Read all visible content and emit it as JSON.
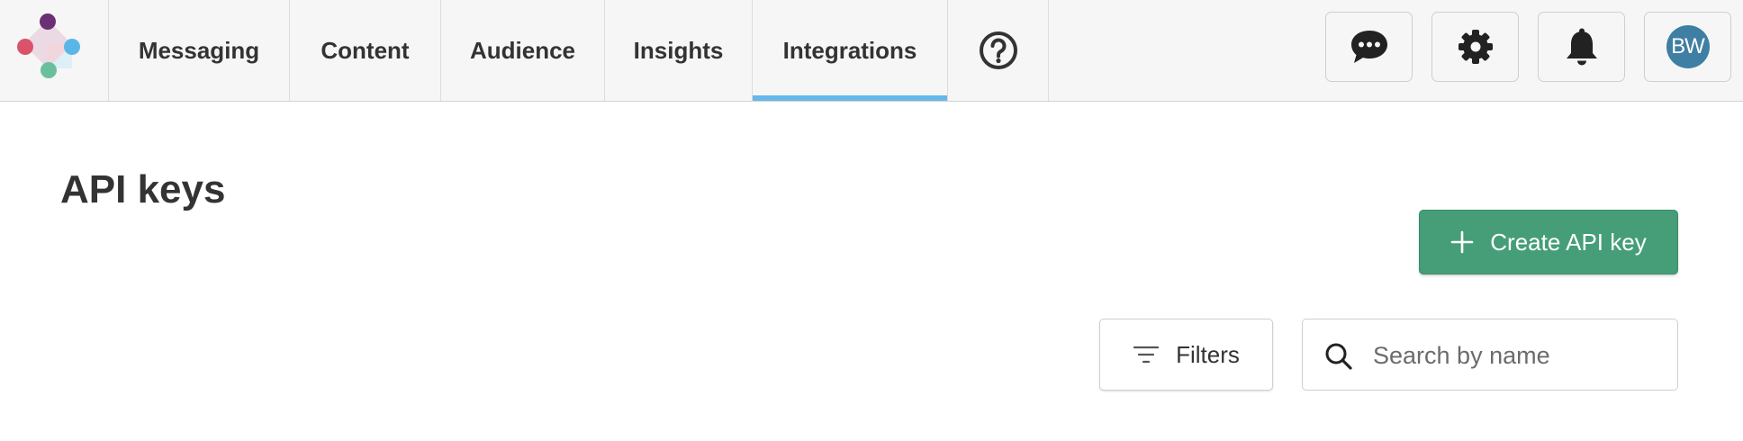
{
  "nav": {
    "tabs": [
      {
        "label": "Messaging"
      },
      {
        "label": "Content"
      },
      {
        "label": "Audience"
      },
      {
        "label": "Insights"
      },
      {
        "label": "Integrations",
        "active": true
      }
    ],
    "help_icon": "question-circle-icon"
  },
  "header": {
    "buttons": [
      {
        "icon": "chat-icon"
      },
      {
        "icon": "gear-icon"
      },
      {
        "icon": "bell-icon"
      }
    ],
    "avatar_initials": "BW",
    "avatar_color": "#3f7fa3"
  },
  "page": {
    "title": "API keys",
    "create_label": "Create API key",
    "filters_label": "Filters",
    "search_placeholder": "Search by name",
    "search_value": ""
  },
  "colors": {
    "accent_tab": "#66b7ea",
    "primary_button": "#459e78"
  }
}
